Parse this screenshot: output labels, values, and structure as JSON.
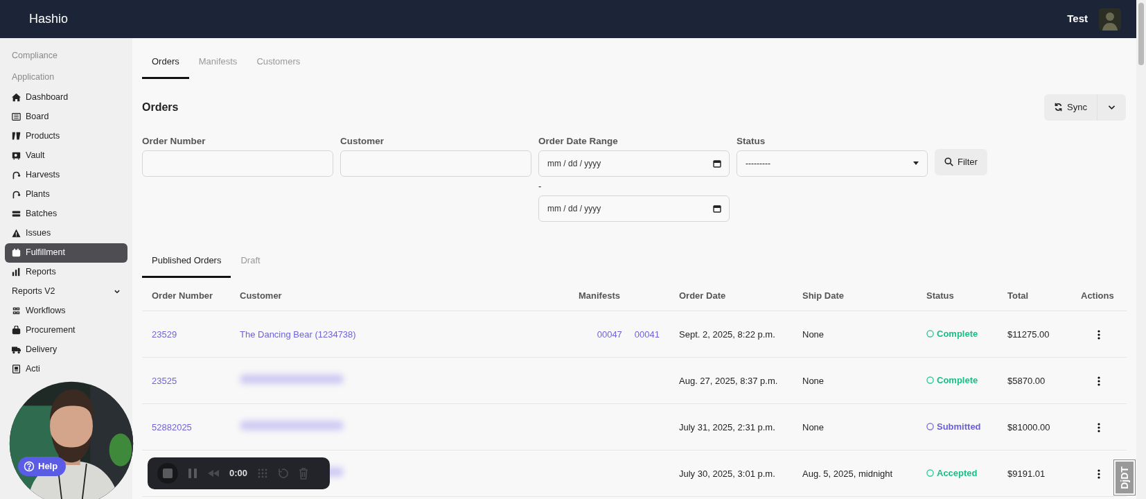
{
  "header": {
    "brand": "Hashio",
    "user": "Test"
  },
  "sidebar": {
    "headings": [
      "Compliance",
      "Application"
    ],
    "items": [
      {
        "label": "Dashboard",
        "selected": false
      },
      {
        "label": "Board",
        "selected": false
      },
      {
        "label": "Products",
        "selected": false
      },
      {
        "label": "Vault",
        "selected": false
      },
      {
        "label": "Harvests",
        "selected": false
      },
      {
        "label": "Plants",
        "selected": false
      },
      {
        "label": "Batches",
        "selected": false
      },
      {
        "label": "Issues",
        "selected": false
      },
      {
        "label": "Fulfillment",
        "selected": true
      },
      {
        "label": "Reports",
        "selected": false
      },
      {
        "label": "Reports V2",
        "selected": false,
        "kind": "group",
        "expanded": false
      },
      {
        "label": "Workflows",
        "selected": false
      },
      {
        "label": "Procurement",
        "selected": false
      },
      {
        "label": "Delivery",
        "selected": false
      },
      {
        "label": "Acti",
        "selected": false
      }
    ]
  },
  "tabs": [
    {
      "label": "Orders",
      "selected": true
    },
    {
      "label": "Manifests",
      "selected": false
    },
    {
      "label": "Customers",
      "selected": false
    }
  ],
  "page_title": "Orders",
  "sync_button": "Sync",
  "filters": {
    "order_number": {
      "label": "Order Number"
    },
    "customer": {
      "label": "Customer"
    },
    "date_range": {
      "label": "Order Date Range",
      "separator": "-",
      "start_placeholder": "mm / dd / yyyy",
      "end_placeholder": "mm / dd / yyyy"
    },
    "status": {
      "label": "Status",
      "value": "---------"
    },
    "filter_button": "Filter"
  },
  "order_tabs": [
    {
      "label": "Published Orders",
      "selected": true
    },
    {
      "label": "Draft",
      "selected": false
    }
  ],
  "table": {
    "columns": [
      "Order Number",
      "Customer",
      "Manifests",
      "Order Date",
      "Ship Date",
      "Status",
      "Total",
      "Actions"
    ],
    "rows": [
      {
        "order_number": "23529",
        "customer": "The Dancing Bear (1234738)",
        "customer_redacted": false,
        "manifests": [
          "00047",
          "00041"
        ],
        "order_date": "Sept. 2, 2025, 8:22 p.m.",
        "ship_date": "None",
        "status": {
          "label": "Complete",
          "color": "#17bf88"
        },
        "total": "$11275.00"
      },
      {
        "order_number": "23525",
        "customer_redacted": true,
        "order_date": "Aug. 27, 2025, 8:37 p.m.",
        "ship_date": "None",
        "status": {
          "label": "Complete",
          "color": "#17bf88"
        },
        "total": "$5870.00"
      },
      {
        "order_number": "52882025",
        "customer_redacted": true,
        "order_date": "July 31, 2025, 2:31 p.m.",
        "ship_date": "None",
        "status": {
          "label": "Submitted",
          "color": "#6a5fd8"
        },
        "total": "$81000.00"
      },
      {
        "customer_redacted": true,
        "order_date": "July 30, 2025, 3:01 p.m.",
        "ship_date": "Aug. 5, 2025, midnight",
        "status": {
          "label": "Accepted",
          "color": "#17bf88"
        },
        "total": "$9191.01"
      }
    ]
  },
  "help_button": "Help",
  "recorder": {
    "time": "0:00"
  },
  "debug_toolbar": "DjDT"
}
